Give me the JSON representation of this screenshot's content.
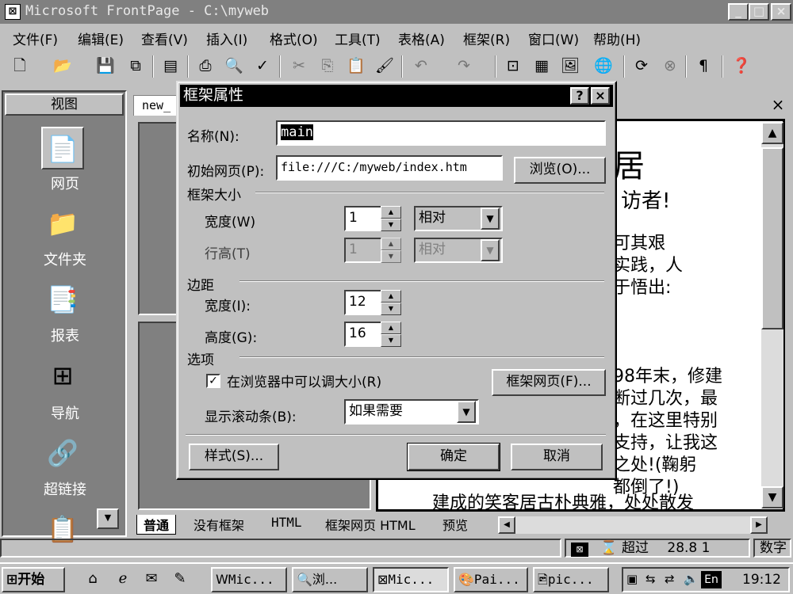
{
  "window": {
    "title": "Microsoft FrontPage - C:\\myweb",
    "controls": {
      "minimize": "_",
      "maximize": "□",
      "close": "×"
    }
  },
  "menu": [
    "文件(F)",
    "编辑(E)",
    "查看(V)",
    "插入(I)",
    "格式(O)",
    "工具(T)",
    "表格(A)",
    "框架(R)",
    "窗口(W)",
    "帮助(H)"
  ],
  "toolbar": {
    "icons": [
      "new-page-icon",
      "open-icon",
      "save-icon",
      "publish-icon",
      "folder-list-icon",
      "print-icon",
      "print-preview-icon",
      "spelling-icon",
      "cut-icon",
      "copy-icon",
      "paste-icon",
      "format-painter-icon",
      "undo-icon",
      "redo-icon",
      "insert-component-icon",
      "insert-table-icon",
      "insert-image-icon",
      "hyperlink-icon",
      "refresh-icon",
      "stop-icon",
      "show-all-icon",
      "help-icon"
    ]
  },
  "views": {
    "header": "视图",
    "items": [
      {
        "label": "网页",
        "icon": "page-view-icon"
      },
      {
        "label": "文件夹",
        "icon": "folders-view-icon"
      },
      {
        "label": "报表",
        "icon": "reports-view-icon"
      },
      {
        "label": "导航",
        "icon": "navigation-view-icon"
      },
      {
        "label": "超链接",
        "icon": "hyperlinks-view-icon"
      }
    ]
  },
  "document": {
    "tab_label": "new_",
    "close": "×",
    "page_lines": [
      "居",
      "访者!",
      "可其艰",
      "实践，人",
      "于悟出:",
      "98年末，修建",
      "断过几次，最",
      "，在这里特别",
      "支持，让我这",
      "之处!(鞠躬",
      "都倒了!)",
      "建成的笑客居古朴典雅，处处散发"
    ],
    "view_tabs": [
      "普通",
      "没有框架",
      "HTML",
      "框架网页 HTML",
      "预览"
    ]
  },
  "dialog": {
    "title": "框架属性",
    "help_btn": "?",
    "close_btn": "×",
    "name_label": "名称(N):",
    "name_value": "main",
    "initial_page_label": "初始网页(P):",
    "initial_page_value": "file:///C:/myweb/index.htm",
    "browse_button": "浏览(O)...",
    "frame_size_group": "框架大小",
    "width_label": "宽度(W)",
    "width_value": "1",
    "width_unit": "相对",
    "row_height_label": "行高(T)",
    "row_height_value": "1",
    "row_height_unit": "相对",
    "margins_group": "边距",
    "margin_width_label": "宽度(I):",
    "margin_width_value": "12",
    "margin_height_label": "高度(G):",
    "margin_height_value": "16",
    "options_group": "选项",
    "resizable_label": "在浏览器中可以调大小(R)",
    "resizable_checked": true,
    "frames_page_button": "框架网页(F)...",
    "scrollbars_label": "显示滚动条(B):",
    "scrollbars_value": "如果需要",
    "style_button": "样式(S)...",
    "ok_button": "确定",
    "cancel_button": "取消"
  },
  "statusbar": {
    "mode_text": "超过",
    "speed": "28.8 1",
    "numlock": "数字"
  },
  "taskbar": {
    "start": "开始",
    "tasks": [
      "Mic...",
      "浏...",
      "Mic...",
      "Pai...",
      "pic..."
    ],
    "language": "En",
    "clock": "19:12"
  }
}
